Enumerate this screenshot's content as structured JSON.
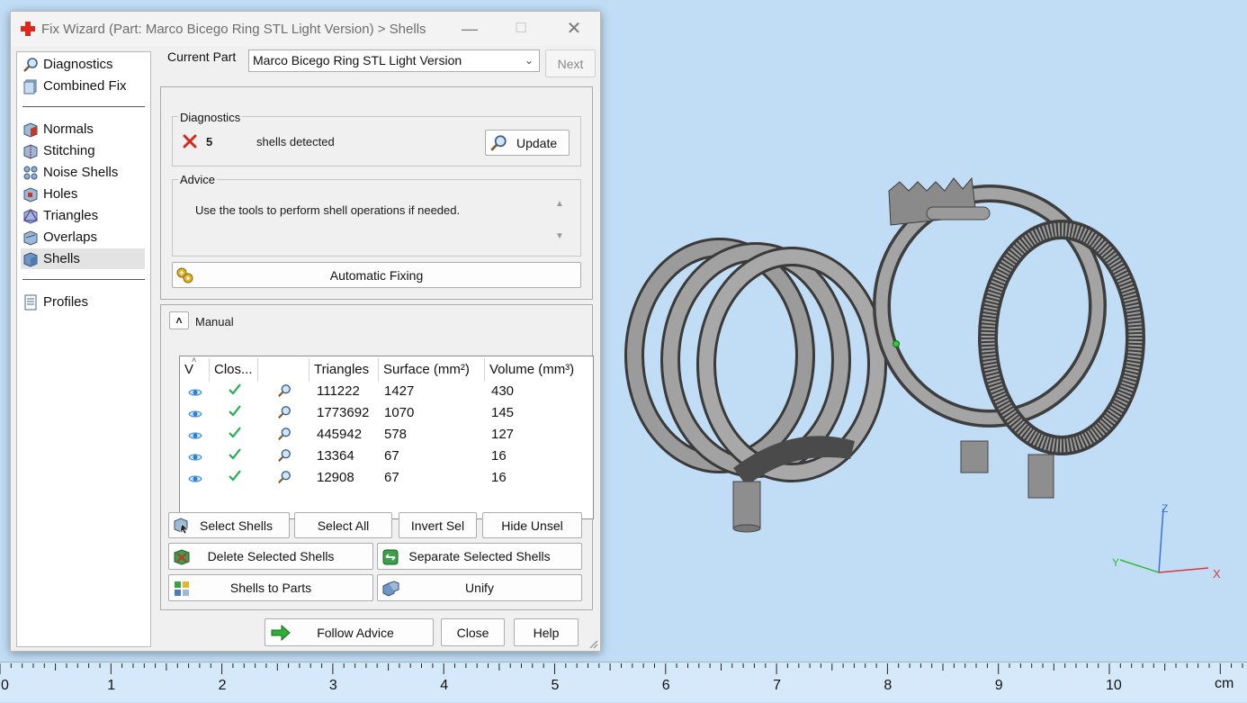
{
  "dialog": {
    "title": "Fix Wizard (Part: Marco Bicego Ring STL Light Version) > Shells",
    "controls": {
      "minimize": "—",
      "maximize": "☐",
      "close": "✕"
    }
  },
  "nav": {
    "group1": [
      {
        "label": "Diagnostics",
        "icon": "magnifier-icon"
      },
      {
        "label": "Combined Fix",
        "icon": "stack-icon"
      }
    ],
    "group2": [
      {
        "label": "Normals",
        "icon": "normals-icon"
      },
      {
        "label": "Stitching",
        "icon": "stitching-icon"
      },
      {
        "label": "Noise Shells",
        "icon": "noise-shells-icon"
      },
      {
        "label": "Holes",
        "icon": "holes-icon"
      },
      {
        "label": "Triangles",
        "icon": "triangles-icon"
      },
      {
        "label": "Overlaps",
        "icon": "overlaps-icon"
      },
      {
        "label": "Shells",
        "icon": "shells-icon",
        "selected": true
      }
    ],
    "group3": [
      {
        "label": "Profiles",
        "icon": "document-icon"
      }
    ]
  },
  "current_part": {
    "label": "Current Part",
    "value": "Marco Bicego Ring STL Light Version",
    "next_label": "Next"
  },
  "diagnostics": {
    "title": "Diagnostics",
    "count": "5",
    "text": "shells detected",
    "update_label": "Update"
  },
  "advice": {
    "title": "Advice",
    "text": "Use the tools to perform shell operations if needed."
  },
  "automatic_fixing_label": "Automatic Fixing",
  "manual": {
    "label": "Manual",
    "columns": [
      "V",
      "Clos...",
      "",
      "Triangles",
      "Surface (mm²)",
      "Volume (mm³)"
    ],
    "rows": [
      {
        "triangles": "111222",
        "surface": "1427",
        "volume": "430"
      },
      {
        "triangles": "1773692",
        "surface": "1070",
        "volume": "145"
      },
      {
        "triangles": "445942",
        "surface": "578",
        "volume": "127"
      },
      {
        "triangles": "13364",
        "surface": "67",
        "volume": "16"
      },
      {
        "triangles": "12908",
        "surface": "67",
        "volume": "16"
      }
    ],
    "buttons": {
      "select_shells": "Select Shells",
      "select_all": "Select All",
      "invert_sel": "Invert Sel",
      "hide_unsel": "Hide Unsel",
      "delete_selected": "Delete Selected Shells",
      "separate_selected": "Separate Selected Shells",
      "shells_to_parts": "Shells to Parts",
      "unify": "Unify"
    }
  },
  "footer": {
    "follow_advice": "Follow Advice",
    "close": "Close",
    "help": "Help"
  },
  "axes": {
    "z": "Z",
    "y": "Y",
    "x": "X"
  },
  "ruler": {
    "labels": [
      "0",
      "1",
      "2",
      "3",
      "4",
      "5",
      "6",
      "7",
      "8",
      "9",
      "10"
    ],
    "unit": "cm"
  },
  "colors": {
    "viewport_bg": "#c1ddf5",
    "check_green": "#22b14c",
    "error_red": "#d42a1e",
    "eye_blue": "#2a7fd4"
  }
}
